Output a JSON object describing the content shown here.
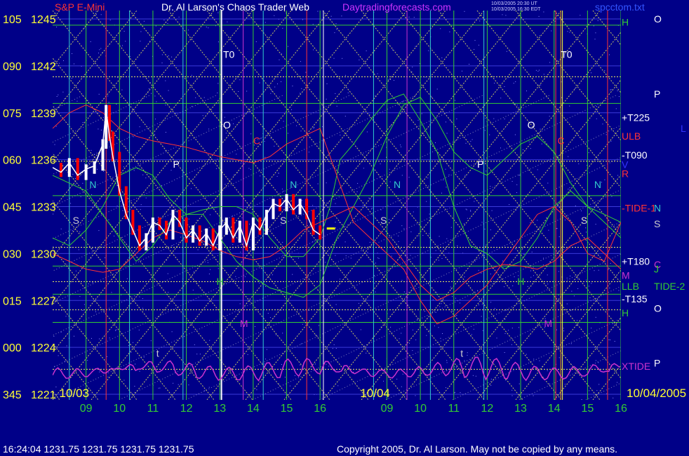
{
  "header": {
    "symbol": "S&P E-Mini",
    "title": "Dr. Al Larson's Chaos Trader Web",
    "site": "Daytradingforecasts.com",
    "stamp1": "10/03/2005 20:30 UT",
    "stamp2": "10/03/2005 16:30 EDT",
    "file": "spcctom.txt"
  },
  "footer": {
    "quote": "16:24:04  1231.75  1231.75  1231.75  1231.75",
    "copyright": "Copyright 2005, Dr. Al Larson. May not be copied by any means."
  },
  "chart_data": {
    "type": "line",
    "ylim": [
      1221,
      1245
    ],
    "y_ticks": [
      {
        "angle": "105",
        "price": "1245",
        "value": 1245
      },
      {
        "angle": "090",
        "price": "1242",
        "value": 1242
      },
      {
        "angle": "075",
        "price": "1239",
        "value": 1239
      },
      {
        "angle": "060",
        "price": "1236",
        "value": 1236
      },
      {
        "angle": "045",
        "price": "1233",
        "value": 1233
      },
      {
        "angle": "030",
        "price": "1230",
        "value": 1230
      },
      {
        "angle": "015",
        "price": "1227",
        "value": 1227
      },
      {
        "angle": "000",
        "price": "1224",
        "value": 1224
      },
      {
        "angle": "345",
        "price": "1221",
        "value": 1221
      }
    ],
    "x_ticks": [
      {
        "label": "09",
        "hour": 9
      },
      {
        "label": "10",
        "hour": 10
      },
      {
        "label": "11",
        "hour": 11
      },
      {
        "label": "12",
        "hour": 12
      },
      {
        "label": "13",
        "hour": 13
      },
      {
        "label": "14",
        "hour": 14
      },
      {
        "label": "15",
        "hour": 15
      },
      {
        "label": "16",
        "hour": 16
      },
      {
        "label": "09",
        "hour": 18
      },
      {
        "label": "10",
        "hour": 19
      },
      {
        "label": "11",
        "hour": 20
      },
      {
        "label": "12",
        "hour": 21
      },
      {
        "label": "13",
        "hour": 22
      },
      {
        "label": "14",
        "hour": 23
      },
      {
        "label": "15",
        "hour": 24
      },
      {
        "label": "16",
        "hour": 25
      }
    ],
    "dates": [
      {
        "label": "10/03",
        "hour": 8.2
      },
      {
        "label": "10/04",
        "hour": 17.2
      },
      {
        "label": "10/04/2005",
        "hour": 25.2
      }
    ],
    "x_range": [
      8.0,
      25.0
    ],
    "price_series": {
      "name": "S&P E-Mini",
      "x": [
        8.0,
        8.25,
        8.5,
        8.75,
        9.0,
        9.25,
        9.5,
        9.6,
        9.7,
        9.8,
        10.0,
        10.2,
        10.4,
        10.6,
        10.8,
        11.0,
        11.2,
        11.4,
        11.6,
        11.8,
        12.0,
        12.2,
        12.4,
        12.6,
        12.8,
        13.0,
        13.2,
        13.4,
        13.6,
        13.8,
        14.0,
        14.2,
        14.4,
        14.6,
        14.8,
        15.0,
        15.2,
        15.4,
        15.6,
        15.8,
        16.0
      ],
      "y": [
        1235.5,
        1235.2,
        1235.8,
        1235.0,
        1235.4,
        1235.6,
        1237.0,
        1239.2,
        1237.5,
        1236.2,
        1234.0,
        1232.5,
        1231.5,
        1230.5,
        1231.0,
        1232.0,
        1231.8,
        1231.2,
        1232.5,
        1232.0,
        1231.0,
        1231.5,
        1230.8,
        1231.3,
        1230.5,
        1231.5,
        1232.0,
        1231.0,
        1231.8,
        1230.5,
        1232.0,
        1231.5,
        1232.5,
        1233.2,
        1233.0,
        1233.5,
        1232.8,
        1233.2,
        1232.5,
        1231.5,
        1231.2
      ]
    },
    "annotations": [
      {
        "text": "T0",
        "hour": 13.1,
        "value": 1242.5,
        "color": "#ffffff"
      },
      {
        "text": "T0",
        "hour": 23.2,
        "value": 1242.5,
        "color": "#ffffff"
      },
      {
        "text": "O",
        "hour": 13.1,
        "value": 1238.0,
        "color": "#ffffff"
      },
      {
        "text": "O",
        "hour": 22.2,
        "value": 1238.0,
        "color": "#ffffff"
      },
      {
        "text": "C",
        "hour": 14.0,
        "value": 1237.0,
        "color": "#ff3333"
      },
      {
        "text": "C",
        "hour": 23.1,
        "value": 1237.0,
        "color": "#ff3333"
      },
      {
        "text": "P",
        "hour": 11.6,
        "value": 1235.5,
        "color": "#ffffff"
      },
      {
        "text": "P",
        "hour": 20.7,
        "value": 1235.5,
        "color": "#ffffff"
      },
      {
        "text": "N",
        "hour": 9.1,
        "value": 1234.2,
        "color": "#33cccc"
      },
      {
        "text": "N",
        "hour": 15.1,
        "value": 1234.2,
        "color": "#33cccc"
      },
      {
        "text": "N",
        "hour": 18.2,
        "value": 1234.2,
        "color": "#33cccc"
      },
      {
        "text": "N",
        "hour": 24.2,
        "value": 1234.2,
        "color": "#33cccc"
      },
      {
        "text": "S",
        "hour": 8.6,
        "value": 1231.9,
        "color": "#cccccc"
      },
      {
        "text": "S",
        "hour": 14.8,
        "value": 1231.9,
        "color": "#cccccc"
      },
      {
        "text": "S",
        "hour": 17.8,
        "value": 1231.9,
        "color": "#cccccc"
      },
      {
        "text": "S",
        "hour": 23.8,
        "value": 1231.9,
        "color": "#cccccc"
      },
      {
        "text": "H",
        "hour": 12.9,
        "value": 1228.0,
        "color": "#33cc33"
      },
      {
        "text": "H",
        "hour": 21.9,
        "value": 1228.0,
        "color": "#33cc33"
      },
      {
        "text": "M",
        "hour": 13.6,
        "value": 1225.3,
        "color": "#cc33cc"
      },
      {
        "text": "M",
        "hour": 22.7,
        "value": 1225.3,
        "color": "#cc33cc"
      },
      {
        "text": "t",
        "hour": 11.1,
        "value": 1223.4,
        "color": "#cccccc"
      },
      {
        "text": "t",
        "hour": 20.2,
        "value": 1223.4,
        "color": "#cccccc"
      }
    ],
    "right_labels": [
      {
        "text": "H",
        "value": 1244.8,
        "color": "#33cc33",
        "col": 0
      },
      {
        "text": "O",
        "value": 1245.0,
        "color": "#ffffff",
        "col": 1
      },
      {
        "text": "P",
        "value": 1240.2,
        "color": "#ffffff",
        "col": 1
      },
      {
        "text": "+T225",
        "value": 1238.7,
        "color": "#ffffff",
        "col": 0
      },
      {
        "text": "L",
        "value": 1238.0,
        "color": "#3333ff",
        "col": 2
      },
      {
        "text": "ULB",
        "value": 1237.5,
        "color": "#ff3333",
        "col": 0
      },
      {
        "text": "-T090",
        "value": 1236.3,
        "color": "#ffffff",
        "col": 0
      },
      {
        "text": "V",
        "value": 1235.7,
        "color": "#3333ff",
        "col": 0
      },
      {
        "text": "R",
        "value": 1235.1,
        "color": "#ff3333",
        "col": 0
      },
      {
        "text": "-TIDE-1",
        "value": 1232.9,
        "color": "#ff3333",
        "col": 0
      },
      {
        "text": "N",
        "value": 1232.9,
        "color": "#33cccc",
        "col": 1
      },
      {
        "text": "S",
        "value": 1231.9,
        "color": "#cccccc",
        "col": 1
      },
      {
        "text": "+T180",
        "value": 1229.5,
        "color": "#ffffff",
        "col": 0
      },
      {
        "text": "C",
        "value": 1229.3,
        "color": "#cc33cc",
        "col": 1
      },
      {
        "text": "J",
        "value": 1229.0,
        "color": "#33cc33",
        "col": 1
      },
      {
        "text": "M",
        "value": 1228.6,
        "color": "#cc33cc",
        "col": 0
      },
      {
        "text": "LLB",
        "value": 1227.9,
        "color": "#33cc33",
        "col": 0
      },
      {
        "text": "TIDE-2",
        "value": 1227.9,
        "color": "#33cc33",
        "col": 1
      },
      {
        "text": "-T135",
        "value": 1227.1,
        "color": "#ffffff",
        "col": 0
      },
      {
        "text": "O",
        "value": 1226.5,
        "color": "#ffffff",
        "col": 1
      },
      {
        "text": "H",
        "value": 1226.2,
        "color": "#33cc33",
        "col": 0
      },
      {
        "text": "XTIDE",
        "value": 1222.8,
        "color": "#cc33cc",
        "col": 0
      },
      {
        "text": "P",
        "value": 1223.0,
        "color": "#ffffff",
        "col": 1
      }
    ],
    "grid": true
  },
  "colors": {
    "background": "#000088",
    "price": "#ffffff",
    "price_down": "#ff0000",
    "tide": "#ff3333",
    "green_band": "#33cc33",
    "xtide": "#cc33cc",
    "yellow": "#ffff33",
    "gann": "#e8e860"
  }
}
